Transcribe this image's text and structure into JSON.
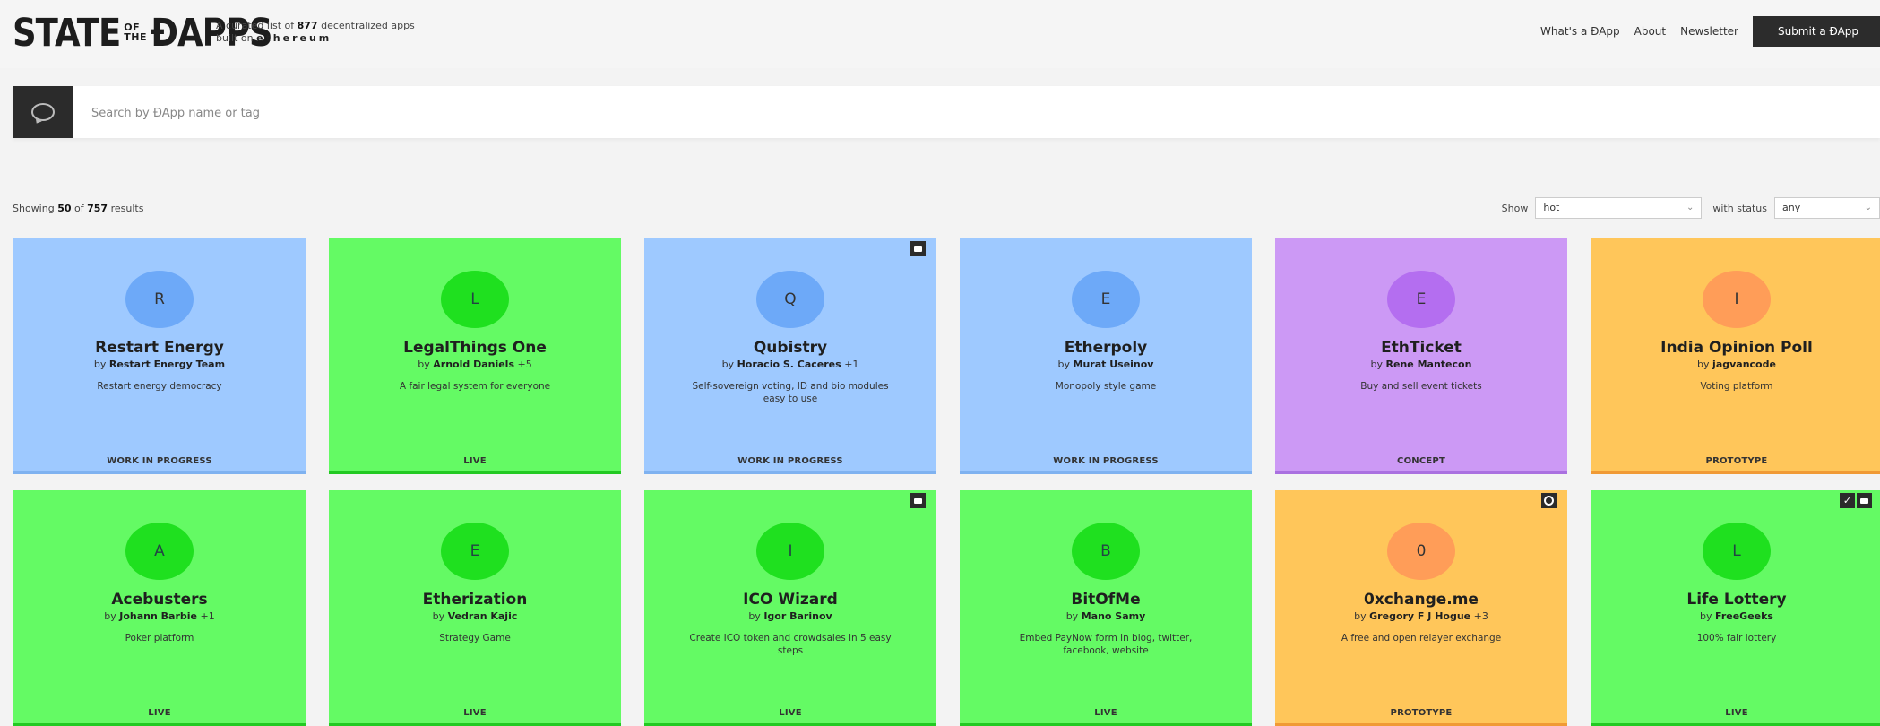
{
  "header": {
    "logo_left": "STATE",
    "logo_small_top": "OF",
    "logo_small_bottom": "THE",
    "logo_right": "ÐAPPS",
    "tagline_pre": "A curated list of",
    "tagline_count": "877",
    "tagline_post": "decentralized apps",
    "tagline_line2_pre": "built on",
    "tagline_line2_chain": "ethereum",
    "nav": [
      "What's a ÐApp",
      "About",
      "Newsletter"
    ],
    "submit_label": "Submit a ÐApp"
  },
  "search": {
    "icon": "chat-bubble-icon",
    "placeholder": "Search by ÐApp name or tag"
  },
  "results": {
    "showing_pre": "Showing",
    "showing_count": "50",
    "showing_mid": "of",
    "showing_total": "757",
    "showing_post": "results",
    "show_label": "Show",
    "sort_value": "hot",
    "status_label": "with status",
    "status_value": "any"
  },
  "cards": [
    {
      "letter": "R",
      "name": "Restart Energy",
      "by": "by",
      "author": "Restart Energy Team",
      "extra": "",
      "desc": "Restart energy democracy",
      "status": "WORK IN PROGRESS",
      "color": "blue",
      "badges": []
    },
    {
      "letter": "L",
      "name": "LegalThings One",
      "by": "by",
      "author": "Arnold Daniels",
      "extra": "+5",
      "desc": "A fair legal system for everyone",
      "status": "LIVE",
      "color": "green",
      "badges": []
    },
    {
      "letter": "Q",
      "name": "Qubistry",
      "by": "by",
      "author": "Horacio S. Caceres",
      "extra": "+1",
      "desc": "Self-sovereign voting, ID and bio modules easy to use",
      "status": "WORK IN PROGRESS",
      "color": "blue",
      "badges": [
        "bookmark"
      ]
    },
    {
      "letter": "E",
      "name": "Etherpoly",
      "by": "by",
      "author": "Murat Useinov",
      "extra": "",
      "desc": "Monopoly style game",
      "status": "WORK IN PROGRESS",
      "color": "blue",
      "badges": []
    },
    {
      "letter": "E",
      "name": "EthTicket",
      "by": "by",
      "author": "Rene Mantecon",
      "extra": "",
      "desc": "Buy and sell event tickets",
      "status": "CONCEPT",
      "color": "purple",
      "badges": []
    },
    {
      "letter": "I",
      "name": "India Opinion Poll",
      "by": "by",
      "author": "jagvancode",
      "extra": "",
      "desc": "Voting platform",
      "status": "PROTOTYPE",
      "color": "orange",
      "badges": []
    },
    {
      "letter": "A",
      "name": "Acebusters",
      "by": "by",
      "author": "Johann Barbie",
      "extra": "+1",
      "desc": "Poker platform",
      "status": "LIVE",
      "color": "green",
      "badges": []
    },
    {
      "letter": "E",
      "name": "Etherization",
      "by": "by",
      "author": "Vedran Kajic",
      "extra": "",
      "desc": "Strategy Game",
      "status": "LIVE",
      "color": "green",
      "badges": []
    },
    {
      "letter": "I",
      "name": "ICO Wizard",
      "by": "by",
      "author": "Igor Barinov",
      "extra": "",
      "desc": "Create ICO token and crowdsales in 5 easy steps",
      "status": "LIVE",
      "color": "green",
      "badges": [
        "bookmark"
      ]
    },
    {
      "letter": "B",
      "name": "BitOfMe",
      "by": "by",
      "author": "Mano Samy",
      "extra": "",
      "desc": "Embed PayNow form in blog, twitter, facebook, website",
      "status": "LIVE",
      "color": "green",
      "badges": []
    },
    {
      "letter": "0",
      "name": "0xchange.me",
      "by": "by",
      "author": "Gregory F J Hogue",
      "extra": "+3",
      "desc": "A free and open relayer exchange",
      "status": "PROTOTYPE",
      "color": "orange",
      "badges": [
        "ring"
      ]
    },
    {
      "letter": "L",
      "name": "Life Lottery",
      "by": "by",
      "author": "FreeGeeks",
      "extra": "",
      "desc": "100% fair lottery",
      "status": "LIVE",
      "color": "green",
      "badges": [
        "check",
        "bookmark"
      ]
    }
  ]
}
